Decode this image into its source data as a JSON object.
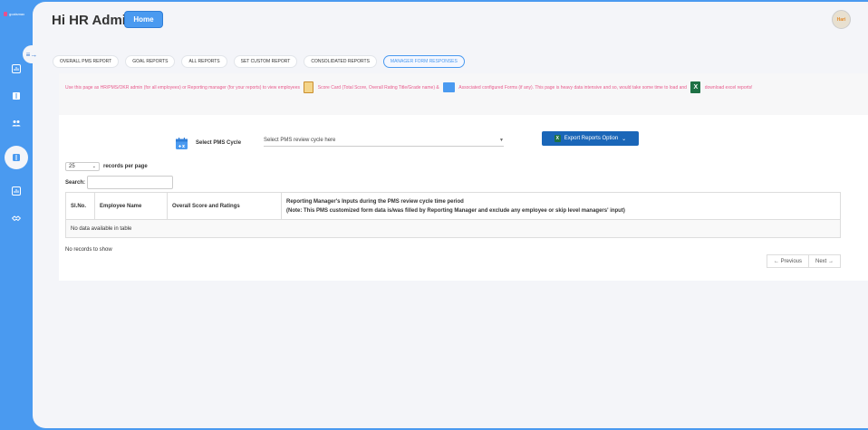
{
  "brand": {
    "logo_text": "goalsmax"
  },
  "header": {
    "greeting": "Hi HR Admin",
    "home_label": "Home",
    "avatar_text": "Hari"
  },
  "tabs": [
    {
      "label": "OVERALL PMS REPORT",
      "active": false
    },
    {
      "label": "GOAL REPORTS",
      "active": false
    },
    {
      "label": "ALL REPORTS",
      "active": false
    },
    {
      "label": "SET CUSTOM REPORT",
      "active": false
    },
    {
      "label": "CONSOLIDATED REPORTS",
      "active": false
    },
    {
      "label": "MANAGER FORM RESPONSES",
      "active": true
    }
  ],
  "notice": {
    "part1": "Use this page as HR/PMS/OKR admin (for all employees) or Reporting manager (for your reports) to view employees",
    "part2": "Score Card (Total Score, Overall Rating Title/Grade name) &",
    "part3": "Associated configured Forms (if any). This page is heavy data intensive and so, would take some time to load and",
    "part4": "download excel reports!"
  },
  "filters": {
    "cycle_label": "Select PMS Cycle",
    "cycle_placeholder": "Select PMS review cycle here",
    "export_label": "Export Reports Option"
  },
  "list_controls": {
    "records_value": "25",
    "records_label": "records per page",
    "search_label": "Search:"
  },
  "table": {
    "headers": {
      "sl_no": "Sl.No.",
      "employee_name": "Employee Name",
      "score": "Overall Score and Ratings",
      "inputs_line1": "Reporting Manager's Inputs during the PMS review cycle time period",
      "inputs_line2": "(Note: This PMS customized form data is/was filled by Reporting Manager and exclude any employee or skip level managers' input)"
    },
    "empty_message": "No data available in table"
  },
  "footer": {
    "no_records": "No records to show",
    "previous": "← Previous",
    "next": "Next →"
  },
  "colors": {
    "brand_blue": "#4a9af0",
    "notice_pink": "#e85a8c",
    "export_blue": "#1a66b8"
  }
}
